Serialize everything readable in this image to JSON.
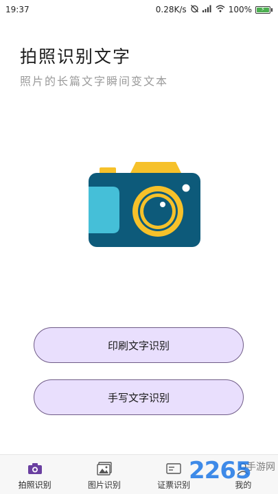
{
  "status_bar": {
    "time": "19:37",
    "network_speed": "0.28K/s",
    "battery_percent": "100%",
    "icons": [
      "alarm-off-icon",
      "signal-icon",
      "wifi-icon",
      "battery-charging-icon"
    ]
  },
  "header": {
    "title": "拍照识别文字",
    "subtitle": "照片的长篇文字瞬间变文本"
  },
  "hero": {
    "icon": "camera-icon",
    "colors": {
      "body": "#0d5a7a",
      "grip": "#45bfd8",
      "top": "#f6c12a",
      "lens_ring": "#f6c12a",
      "lens": "#0d5a7a"
    }
  },
  "actions": {
    "print_ocr_label": "印刷文字识别",
    "handwriting_ocr_label": "手写文字识别",
    "button_color": "#e9dffd",
    "button_border": "#6e5a86"
  },
  "tab_bar": {
    "accent": "#6a3fa0",
    "tabs": [
      {
        "label": "拍照识别",
        "icon": "camera-icon",
        "active": true
      },
      {
        "label": "图片识别",
        "icon": "image-icon",
        "active": false
      },
      {
        "label": "证票识别",
        "icon": "id-card-icon",
        "active": false
      },
      {
        "label": "我的",
        "icon": "user-icon",
        "active": false
      }
    ]
  },
  "watermark": {
    "number": "2265",
    "text": "手游网"
  }
}
